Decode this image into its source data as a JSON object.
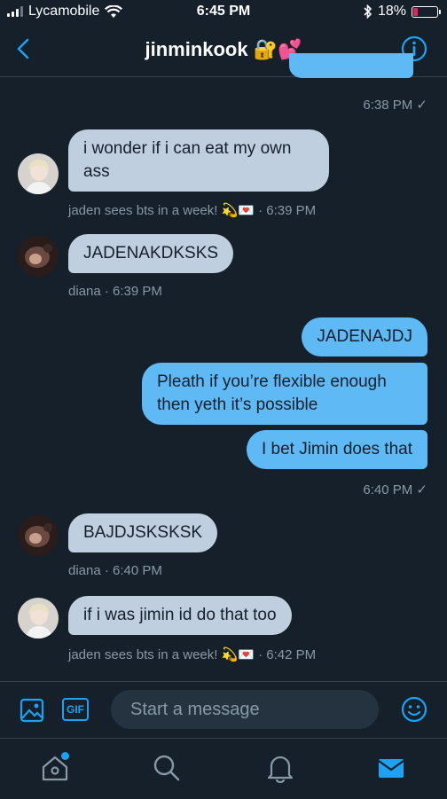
{
  "status_bar": {
    "carrier": "Lycamobile",
    "time": "6:45 PM",
    "battery_percent": "18%",
    "battery_level": 0.18
  },
  "header": {
    "title": "jinminkook 🔐💕"
  },
  "messages": [
    {
      "type": "out",
      "text": "",
      "meta": "6:38 PM ✓"
    },
    {
      "type": "in",
      "text": "i wonder if i can eat my own ass",
      "meta": "jaden sees bts in a week! 💫💌 · 6:39 PM",
      "avatar": "avatar-jaden"
    },
    {
      "type": "in",
      "text": "JADENAKDKSKS",
      "meta": "diana · 6:39 PM",
      "avatar": "avatar-diana"
    },
    {
      "type": "out",
      "text": "JADENAJDJ"
    },
    {
      "type": "out",
      "text": "Pleath if you’re flexible enough then yeth it’s possible"
    },
    {
      "type": "out",
      "text": "I bet Jimin does that",
      "meta": "6:40 PM ✓"
    },
    {
      "type": "in",
      "text": "BAJDJSKSKSK",
      "meta": "diana · 6:40 PM",
      "avatar": "avatar-diana"
    },
    {
      "type": "in",
      "text": "if i was jimin id do that too",
      "meta": "jaden sees bts in a week! 💫💌 · 6:42 PM",
      "avatar": "avatar-jaden"
    }
  ],
  "compose": {
    "placeholder": "Start a message",
    "gif_label": "GIF"
  },
  "colors": {
    "background": "#15202b",
    "accent": "#1da1f2",
    "incoming_bubble": "#c0cfe0",
    "outgoing_bubble": "#5fb9f5"
  }
}
